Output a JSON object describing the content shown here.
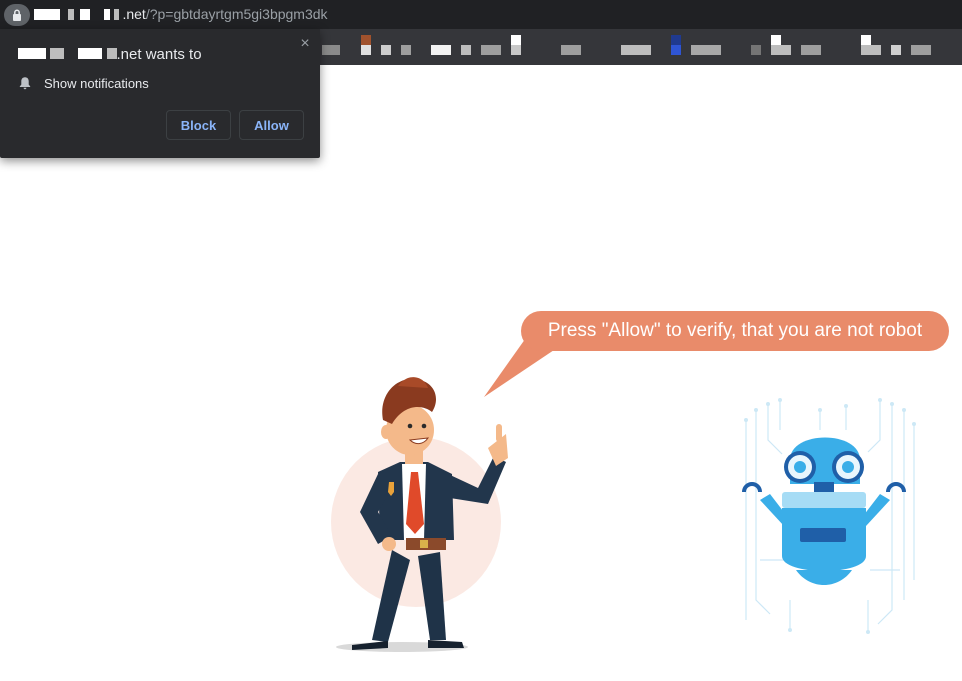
{
  "browser": {
    "url_domain_suffix": ".net",
    "url_path": "/?p=gbtdayrtgm5gi3bpgm3dk"
  },
  "notification_prompt": {
    "title_suffix": ".net wants to",
    "permission_label": "Show notifications",
    "block_label": "Block",
    "allow_label": "Allow",
    "close_icon": "×"
  },
  "page": {
    "speech_bubble_text": "Press \"Allow\" to verify, that you are not robot"
  },
  "colors": {
    "bubble": "#e98b6a",
    "browser_dark": "#202124",
    "popup_bg": "#292a2d",
    "button_text": "#8ab4f8",
    "robot_blue": "#3aaee8"
  }
}
